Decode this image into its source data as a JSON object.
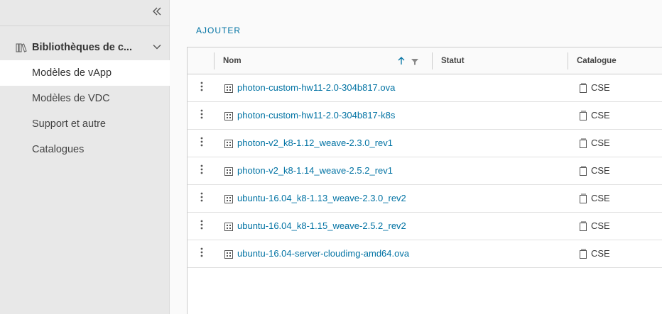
{
  "sidebar": {
    "group_label": "Bibliothèques de c...",
    "items": [
      {
        "label": "Modèles de vApp",
        "active": true
      },
      {
        "label": "Modèles de VDC",
        "active": false
      },
      {
        "label": "Support et autre",
        "active": false
      },
      {
        "label": "Catalogues",
        "active": false
      }
    ]
  },
  "toolbar": {
    "add_label": "AJOUTER"
  },
  "grid": {
    "columns": {
      "name": "Nom",
      "status": "Statut",
      "catalog": "Catalogue"
    },
    "rows": [
      {
        "name": "photon-custom-hw11-2.0-304b817.ova",
        "status": "",
        "catalog": "CSE"
      },
      {
        "name": "photon-custom-hw11-2.0-304b817-k8s",
        "status": "",
        "catalog": "CSE"
      },
      {
        "name": "photon-v2_k8-1.12_weave-2.3.0_rev1",
        "status": "",
        "catalog": "CSE"
      },
      {
        "name": "photon-v2_k8-1.14_weave-2.5.2_rev1",
        "status": "",
        "catalog": "CSE"
      },
      {
        "name": "ubuntu-16.04_k8-1.13_weave-2.3.0_rev2",
        "status": "",
        "catalog": "CSE"
      },
      {
        "name": "ubuntu-16.04_k8-1.15_weave-2.5.2_rev2",
        "status": "",
        "catalog": "CSE"
      },
      {
        "name": "ubuntu-16.04-server-cloudimg-amd64.ova",
        "status": "",
        "catalog": "CSE"
      }
    ]
  },
  "colors": {
    "link": "#0072a3",
    "sidebar_bg": "#e8e8e8"
  }
}
